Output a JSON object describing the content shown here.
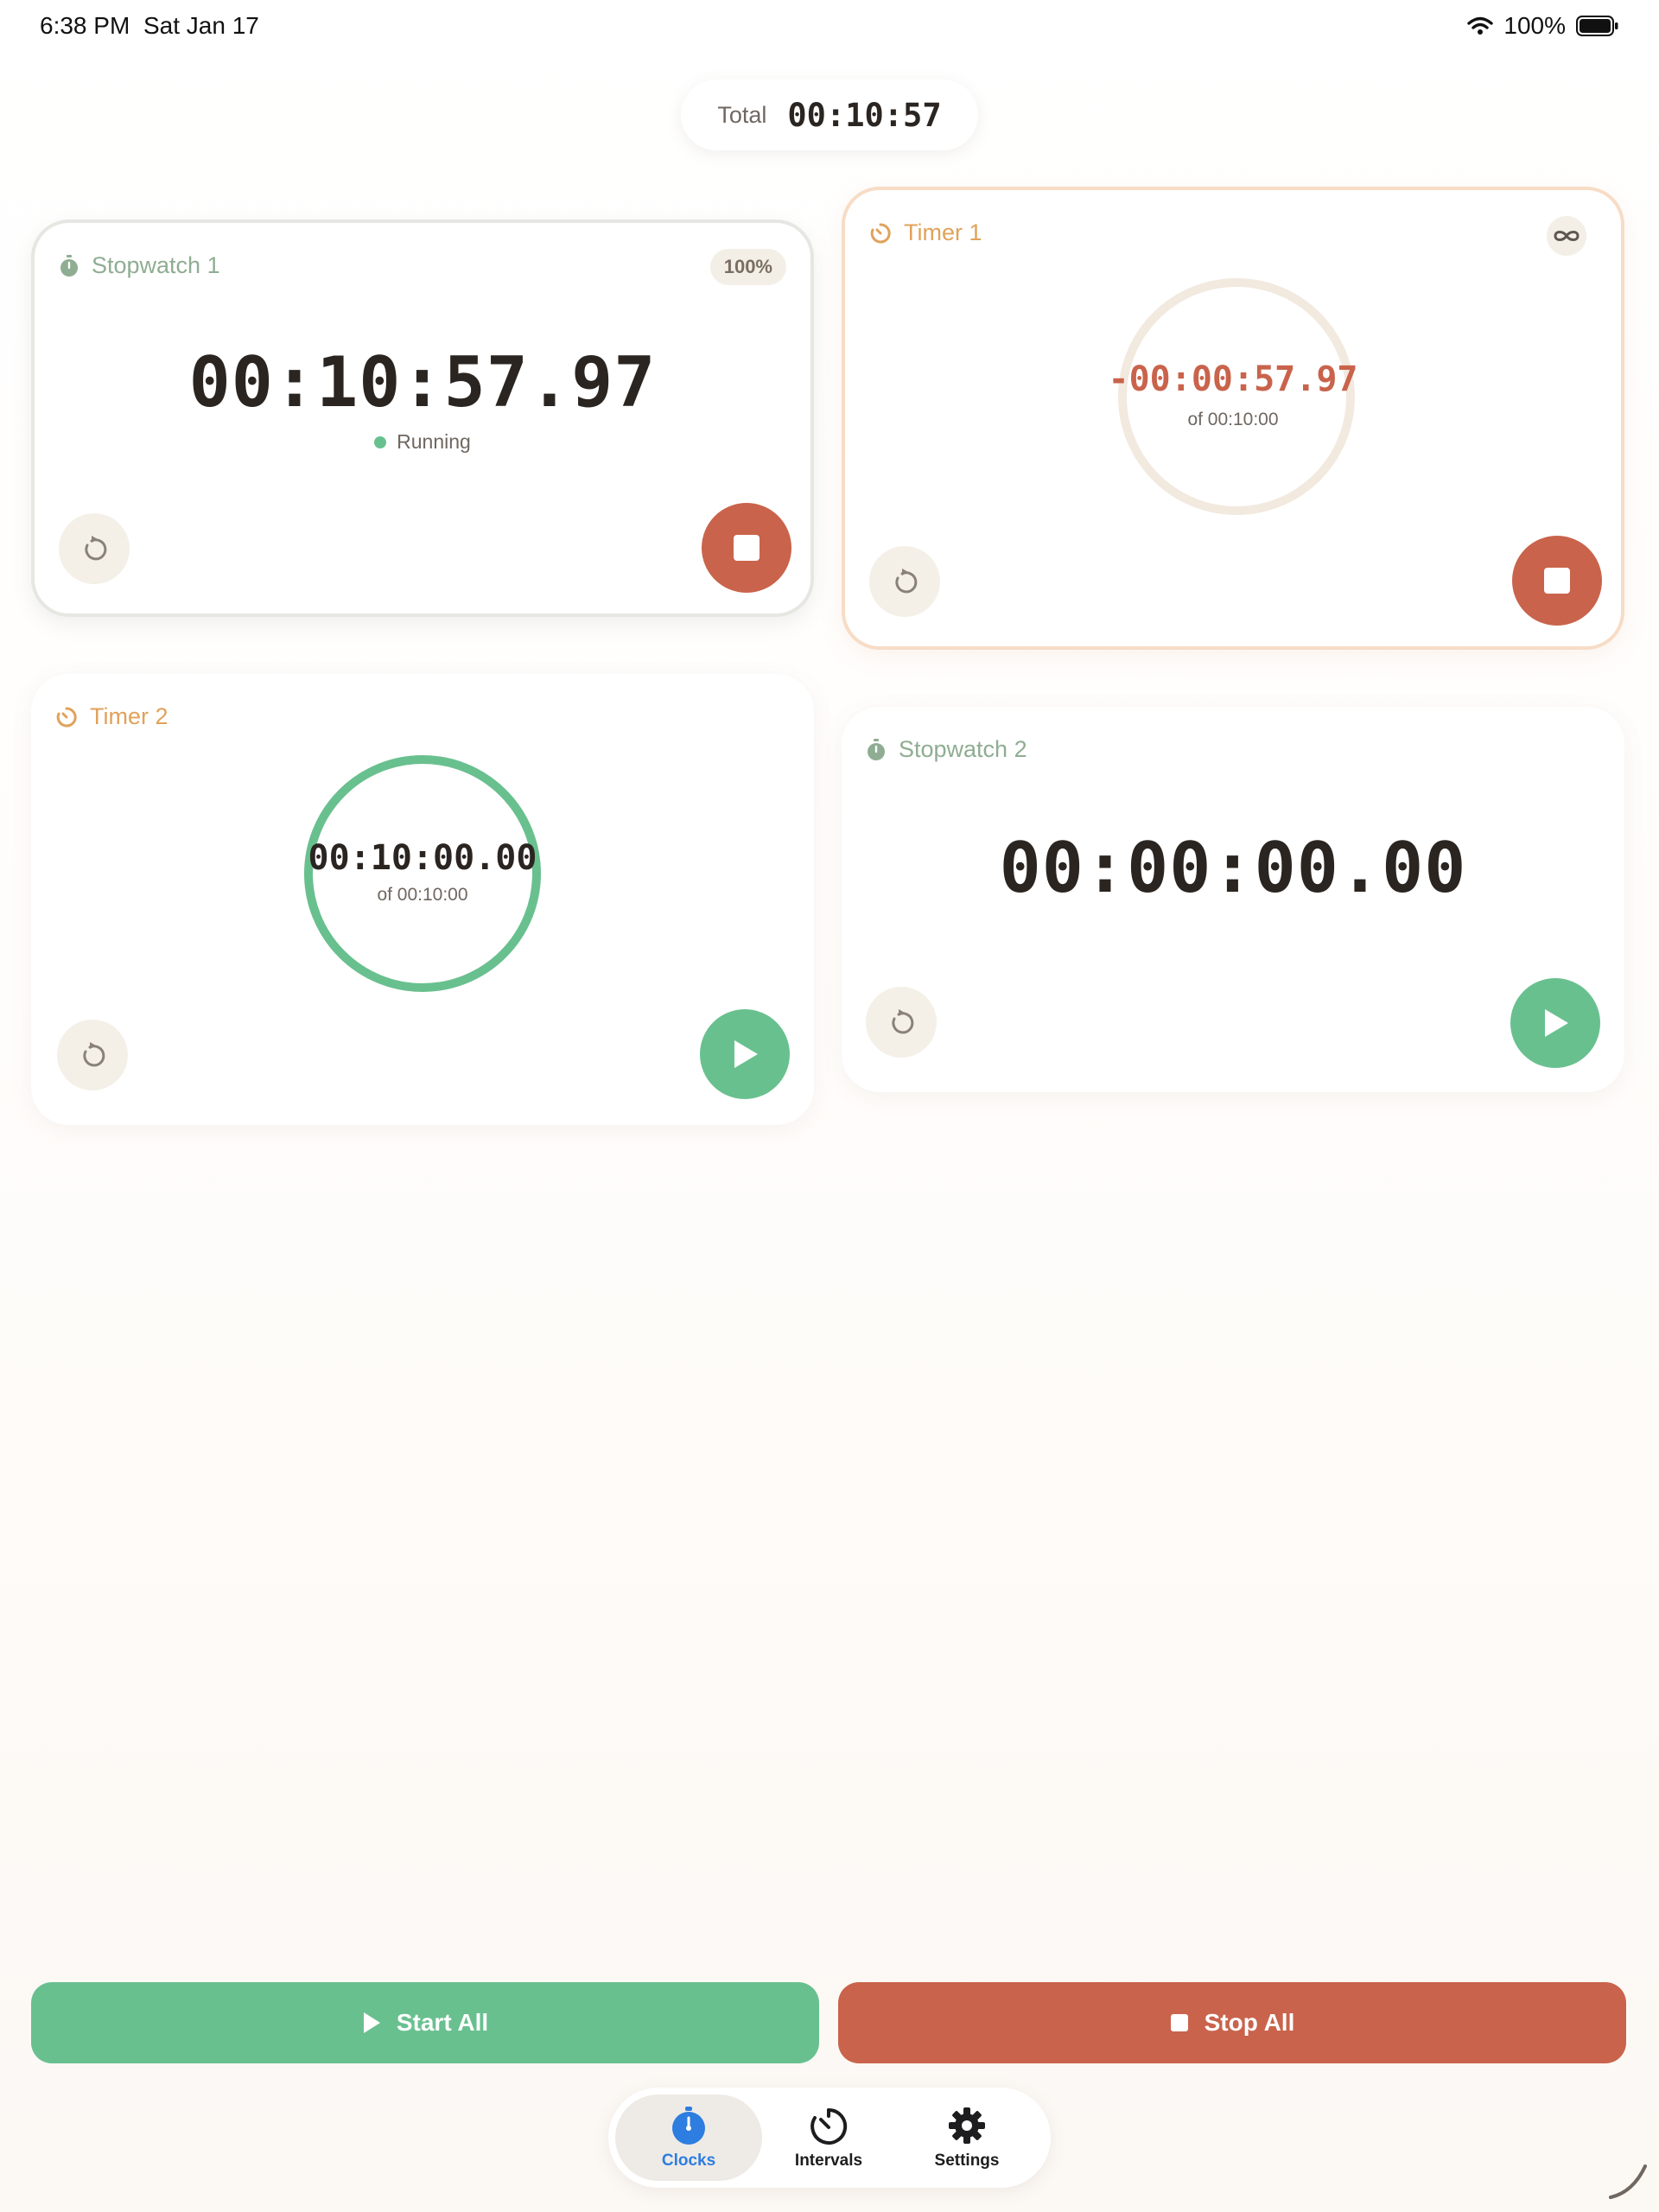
{
  "status_bar": {
    "time": "6:38 PM",
    "date": "Sat Jan 17",
    "battery": "100%"
  },
  "total": {
    "label": "Total",
    "value": "00:10:57"
  },
  "cards": {
    "stopwatch1": {
      "title": "Stopwatch 1",
      "badge": "100%",
      "time": "00:10:57.97",
      "status": "Running"
    },
    "timer1": {
      "title": "Timer 1",
      "time": "-00:00:57.97",
      "of": "of 00:10:00",
      "progress": 1.0
    },
    "timer2": {
      "title": "Timer 2",
      "time": "00:10:00.00",
      "of": "of 00:10:00",
      "progress": 1.0
    },
    "stopwatch2": {
      "title": "Stopwatch 2",
      "time": "00:00:00.00"
    }
  },
  "actions": {
    "start_all": "Start All",
    "stop_all": "Stop All"
  },
  "tabs": [
    {
      "label": "Clocks",
      "icon": "stopwatch-icon",
      "selected": true
    },
    {
      "label": "Intervals",
      "icon": "timer-icon",
      "selected": false
    },
    {
      "label": "Settings",
      "icon": "gear-icon",
      "selected": false
    }
  ],
  "colors": {
    "green": "#69c08f",
    "red": "#c9634b",
    "orange": "#e0a25a",
    "sage": "#8fad92",
    "tab_accent": "#2e7de0"
  }
}
